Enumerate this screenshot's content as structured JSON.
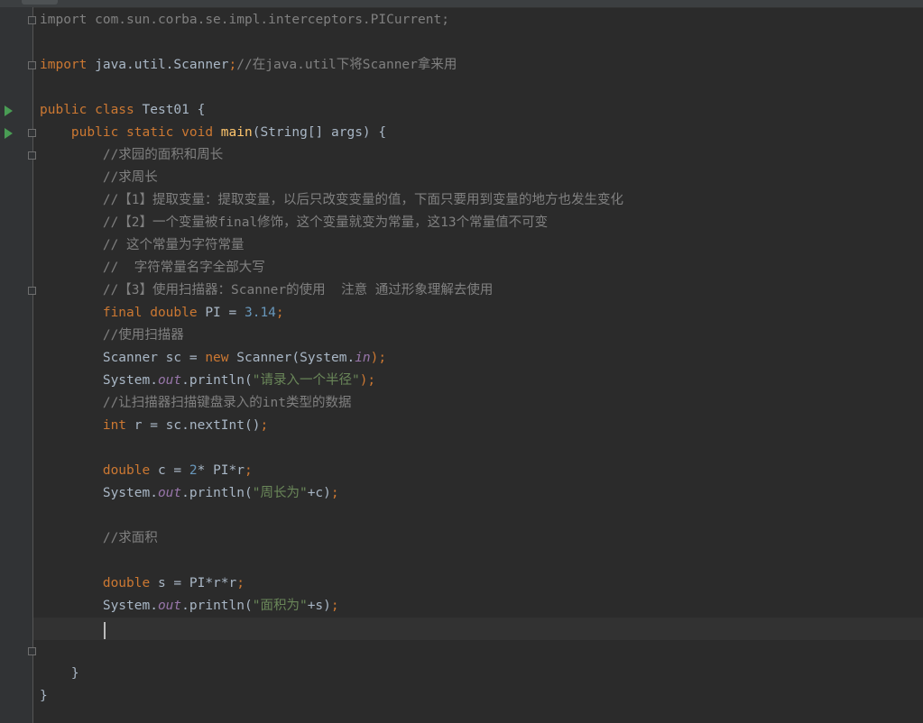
{
  "editor": {
    "lines": [
      {
        "tokens": [
          {
            "t": "import ",
            "c": "imp"
          },
          {
            "t": "com.sun.corba.se.impl.interceptors.PICurrent;",
            "c": "imp"
          }
        ]
      },
      {
        "tokens": []
      },
      {
        "tokens": [
          {
            "t": "import ",
            "c": "kw"
          },
          {
            "t": "java.util.Scanner",
            "c": ""
          },
          {
            "t": ";",
            "c": "kw"
          },
          {
            "t": "//在java.util下将Scanner拿来用",
            "c": "cm"
          }
        ]
      },
      {
        "tokens": []
      },
      {
        "tokens": [
          {
            "t": "public class ",
            "c": "kw"
          },
          {
            "t": "Test01 {",
            "c": ""
          }
        ]
      },
      {
        "tokens": [
          {
            "t": "    public static void ",
            "c": "kw"
          },
          {
            "t": "main",
            "c": "fn"
          },
          {
            "t": "(String[] args) {",
            "c": ""
          }
        ]
      },
      {
        "tokens": [
          {
            "t": "        //求园的面积和周长",
            "c": "cm"
          }
        ]
      },
      {
        "tokens": [
          {
            "t": "        //求周长",
            "c": "cm"
          }
        ]
      },
      {
        "tokens": [
          {
            "t": "        //【1】提取变量：提取变量，以后只改变变量的值，下面只要用到变量的地方也发生变化",
            "c": "cm"
          }
        ]
      },
      {
        "tokens": [
          {
            "t": "        //【2】一个变量被final修饰，这个变量就变为常量，这13个常量值不可变",
            "c": "cm"
          }
        ]
      },
      {
        "tokens": [
          {
            "t": "        // 这个常量为字符常量",
            "c": "cm"
          }
        ]
      },
      {
        "tokens": [
          {
            "t": "        //  字符常量名字全部大写",
            "c": "cm"
          }
        ]
      },
      {
        "tokens": [
          {
            "t": "        //【3】使用扫描器：Scanner的使用  注意 通过形象理解去使用",
            "c": "cm"
          }
        ]
      },
      {
        "tokens": [
          {
            "t": "        final double ",
            "c": "kw"
          },
          {
            "t": "PI = ",
            "c": ""
          },
          {
            "t": "3.14",
            "c": "num"
          },
          {
            "t": ";",
            "c": "kw"
          }
        ]
      },
      {
        "tokens": [
          {
            "t": "        //使用扫描器",
            "c": "cm"
          }
        ]
      },
      {
        "tokens": [
          {
            "t": "        Scanner sc = ",
            "c": ""
          },
          {
            "t": "new ",
            "c": "kw"
          },
          {
            "t": "Scanner(System.",
            "c": ""
          },
          {
            "t": "in",
            "c": "st"
          },
          {
            "t": ");",
            "c": "kw"
          }
        ]
      },
      {
        "tokens": [
          {
            "t": "        System.",
            "c": ""
          },
          {
            "t": "out",
            "c": "st"
          },
          {
            "t": ".println(",
            "c": ""
          },
          {
            "t": "\"请录入一个半径\"",
            "c": "str"
          },
          {
            "t": ");",
            "c": "kw"
          }
        ]
      },
      {
        "tokens": [
          {
            "t": "        //让扫描器扫描键盘录入的int类型的数据",
            "c": "cm"
          }
        ]
      },
      {
        "tokens": [
          {
            "t": "        int ",
            "c": "kw"
          },
          {
            "t": "r = sc.nextInt()",
            "c": ""
          },
          {
            "t": ";",
            "c": "kw"
          }
        ]
      },
      {
        "tokens": []
      },
      {
        "tokens": [
          {
            "t": "        double ",
            "c": "kw"
          },
          {
            "t": "c = ",
            "c": ""
          },
          {
            "t": "2",
            "c": "num"
          },
          {
            "t": "* PI*r",
            "c": ""
          },
          {
            "t": ";",
            "c": "kw"
          }
        ]
      },
      {
        "tokens": [
          {
            "t": "        System.",
            "c": ""
          },
          {
            "t": "out",
            "c": "st"
          },
          {
            "t": ".println(",
            "c": ""
          },
          {
            "t": "\"周长为\"",
            "c": "str"
          },
          {
            "t": "+c)",
            "c": ""
          },
          {
            "t": ";",
            "c": "kw"
          }
        ]
      },
      {
        "tokens": []
      },
      {
        "tokens": [
          {
            "t": "        //求面积",
            "c": "cm"
          }
        ]
      },
      {
        "tokens": []
      },
      {
        "tokens": [
          {
            "t": "        double ",
            "c": "kw"
          },
          {
            "t": "s = PI*r*r",
            "c": ""
          },
          {
            "t": ";",
            "c": "kw"
          }
        ]
      },
      {
        "tokens": [
          {
            "t": "        System.",
            "c": ""
          },
          {
            "t": "out",
            "c": "st"
          },
          {
            "t": ".println(",
            "c": ""
          },
          {
            "t": "\"面积为\"",
            "c": "str"
          },
          {
            "t": "+s)",
            "c": ""
          },
          {
            "t": ";",
            "c": "kw"
          }
        ]
      },
      {
        "tokens": [],
        "current": true
      },
      {
        "tokens": []
      },
      {
        "tokens": [
          {
            "t": "    }",
            "c": ""
          }
        ]
      },
      {
        "tokens": [
          {
            "t": "}",
            "c": ""
          }
        ]
      }
    ]
  },
  "gutter": {
    "run_icon": "run-triangle-icon",
    "fold_icon": "fold-marker-icon"
  },
  "colors": {
    "background": "#2b2b2b",
    "keyword": "#cc7832",
    "comment": "#808080",
    "string": "#6a8759",
    "number": "#6897bb",
    "method": "#ffc66d",
    "static_field": "#9876aa",
    "run_icon": "#499c54"
  }
}
